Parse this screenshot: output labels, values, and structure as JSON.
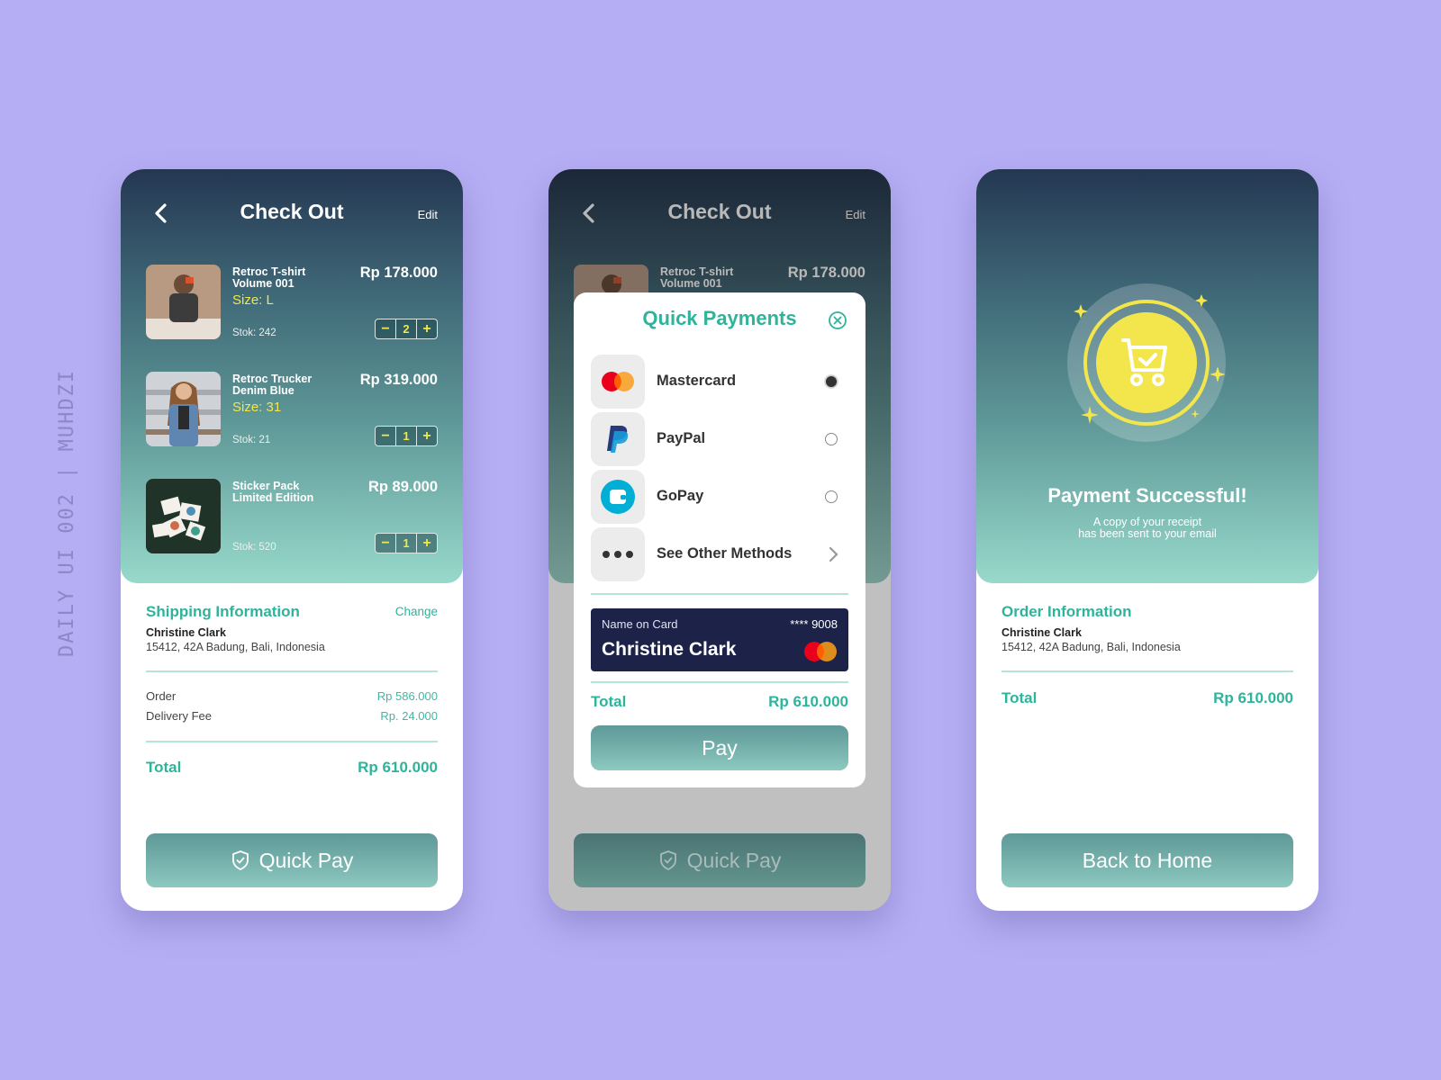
{
  "side_label": "DAILY UI 002 | MUHDZI",
  "colors": {
    "background": "#b6aef5",
    "accent": "#2fb39b",
    "size_highlight": "#f2e64c",
    "card_bg": "#1d2348",
    "header_gradient_top": "#243752",
    "header_gradient_bottom": "#97d9cb"
  },
  "screen1": {
    "header": {
      "back_icon": "chevron-left-icon",
      "title": "Check Out",
      "edit_label": "Edit"
    },
    "items": [
      {
        "name": "Retroc T-shirt Volume 001",
        "size": "Size: L",
        "stock": "Stok: 242",
        "price": "Rp 178.000",
        "qty": "2"
      },
      {
        "name": "Retroc Trucker Denim Blue",
        "size": "Size: 31",
        "stock": "Stok: 21",
        "price": "Rp 319.000",
        "qty": "1"
      },
      {
        "name": "Sticker Pack Limited Edition",
        "size": "",
        "stock": "Stok: 520",
        "price": "Rp 89.000",
        "qty": "1"
      }
    ],
    "stepper": {
      "minus": "−",
      "plus": "+"
    },
    "shipping": {
      "title": "Shipping Information",
      "change_label": "Change",
      "name": "Christine Clark",
      "address": "15412, 42A Badung, Bali, Indonesia"
    },
    "summary": {
      "order_label": "Order",
      "order_value": "Rp 586.000",
      "delivery_label": "Delivery Fee",
      "delivery_value": "Rp. 24.000",
      "total_label": "Total",
      "total_value": "Rp 610.000"
    },
    "quick_pay_label": "Quick Pay"
  },
  "screen2": {
    "header": {
      "title": "Check Out",
      "edit_label": "Edit"
    },
    "item": {
      "name": "Retroc T-shirt Volume 001",
      "price": "Rp 178.000"
    },
    "modal": {
      "title": "Quick Payments",
      "methods": [
        {
          "label": "Mastercard",
          "icon": "mastercard-icon",
          "selected": true
        },
        {
          "label": "PayPal",
          "icon": "paypal-icon",
          "selected": false
        },
        {
          "label": "GoPay",
          "icon": "gopay-wallet-icon",
          "selected": false
        },
        {
          "label": "See Other Methods",
          "icon": "more-dots-icon"
        }
      ],
      "card": {
        "name_label": "Name on Card",
        "number": "**** 9008",
        "holder": "Christine Clark"
      },
      "total_label": "Total",
      "total_value": "Rp 610.000",
      "pay_label": "Pay"
    },
    "quick_pay_label": "Quick Pay"
  },
  "screen3": {
    "title": "Payment Successful!",
    "subtitle_line1": "A copy of your receipt",
    "subtitle_line2": "has been sent to your email",
    "order_info": {
      "title": "Order Information",
      "name": "Christine Clark",
      "address": "15412, 42A Badung, Bali, Indonesia"
    },
    "total_label": "Total",
    "total_value": "Rp 610.000",
    "back_home_label": "Back to Home"
  }
}
